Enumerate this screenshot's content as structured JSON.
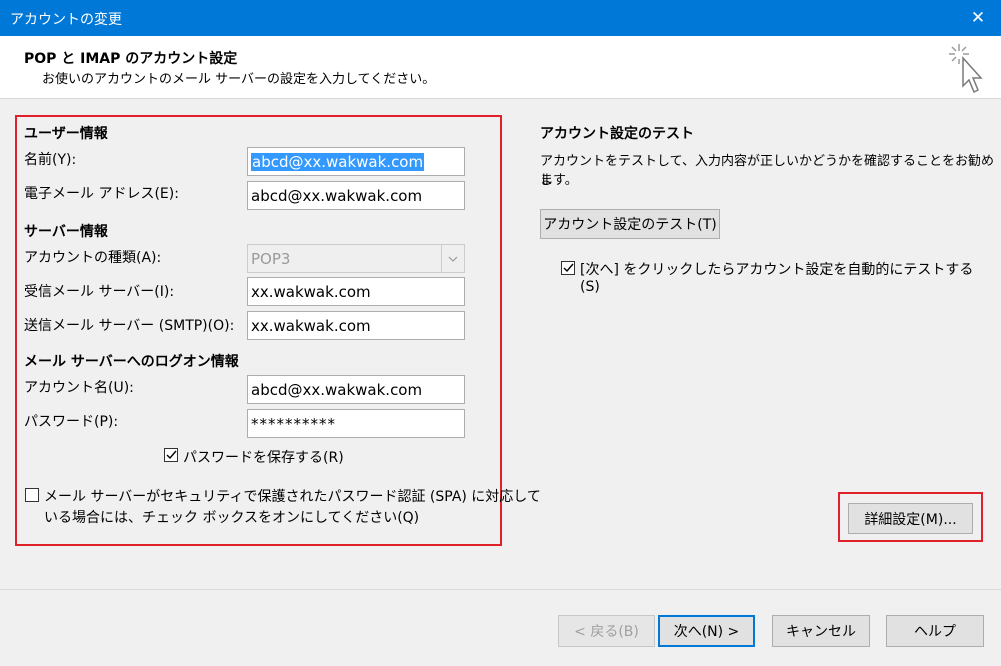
{
  "window": {
    "title": "アカウントの変更",
    "close_glyph": "✕"
  },
  "header": {
    "title": "POP と IMAP のアカウント設定",
    "subtitle": "お使いのアカウントのメール サーバーの設定を入力してください。",
    "icon": "cursor-sparkle-icon"
  },
  "user_info": {
    "heading": "ユーザー情報",
    "name_label": "名前(Y):",
    "name_value": "abcd@xx.wakwak.com",
    "email_label": "電子メール アドレス(E):",
    "email_value": "abcd@xx.wakwak.com"
  },
  "server_info": {
    "heading": "サーバー情報",
    "account_type_label": "アカウントの種類(A):",
    "account_type_value": "POP3",
    "incoming_label": "受信メール サーバー(I):",
    "incoming_value": "xx.wakwak.com",
    "outgoing_label": "送信メール サーバー (SMTP)(O):",
    "outgoing_value": "xx.wakwak.com"
  },
  "logon_info": {
    "heading": "メール サーバーへのログオン情報",
    "account_name_label": "アカウント名(U):",
    "account_name_value": "abcd@xx.wakwak.com",
    "password_label": "パスワード(P):",
    "password_value": "**********",
    "save_password_label": "パスワードを保存する(R)",
    "save_password_checked": true,
    "spa_label_line1": "メール サーバーがセキュリティで保護されたパスワード認証 (SPA) に対応して",
    "spa_label_line2": "いる場合には、チェック ボックスをオンにしてください(Q)",
    "spa_checked": false
  },
  "test": {
    "heading": "アカウント設定のテスト",
    "desc_line1": "アカウントをテストして、入力内容が正しいかどうかを確認することをお勧めし",
    "desc_line2": "ます。",
    "test_button": "アカウント設定のテスト(T)",
    "auto_test_line1": "[次へ] をクリックしたらアカウント設定を自動的にテストする",
    "auto_test_line2": "(S)",
    "auto_test_checked": true
  },
  "more_settings_button": "詳細設定(M)...",
  "footer": {
    "back_button": "< 戻る(B)",
    "next_button": "次へ(N) >",
    "cancel_button": "キャンセル",
    "help_button": "ヘルプ"
  },
  "colors": {
    "title_bar": "#0078d7",
    "highlight_box": "#e0202a",
    "selection": "#3399ff"
  }
}
